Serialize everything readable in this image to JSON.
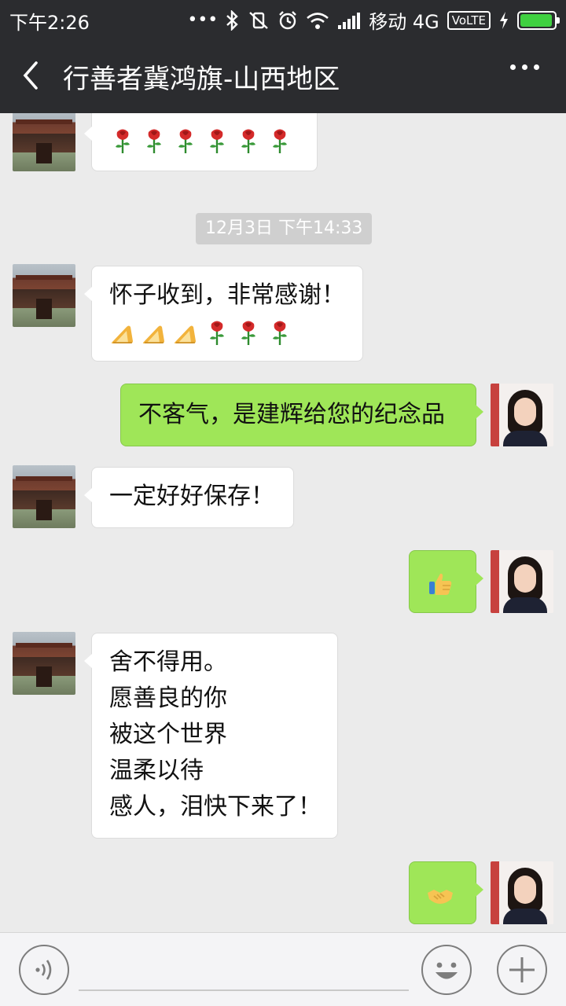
{
  "status": {
    "time": "下午2:26",
    "carrier": "移动 4G",
    "volte": "VoLTE",
    "battery_level": 0.95,
    "icons": [
      "more-dots-icon",
      "bluetooth-icon",
      "silent-icon",
      "alarm-icon",
      "wifi-icon",
      "signal-icon",
      "charging-icon"
    ]
  },
  "header": {
    "title": "行善者冀鸿旗-山西地区",
    "back_icon": "chevron-left-icon",
    "more_icon": "more-icon"
  },
  "chat": {
    "timestamp": "12月3日 下午14:33",
    "messages": [
      {
        "from": "them",
        "emoji": [
          "rose",
          "rose",
          "rose",
          "rose",
          "rose",
          "rose"
        ]
      },
      {
        "from": "them",
        "lines": [
          "怀子收到，非常感谢！"
        ],
        "emoji": [
          "prayer",
          "prayer",
          "prayer",
          "rose",
          "rose",
          "rose"
        ]
      },
      {
        "from": "me",
        "lines": [
          "不客气，是建辉给您的纪念品"
        ]
      },
      {
        "from": "them",
        "lines": [
          "一定好好保存！"
        ]
      },
      {
        "from": "me",
        "emoji": [
          "thumbs-up"
        ]
      },
      {
        "from": "them",
        "lines": [
          "舍不得用。",
          "愿善良的你",
          "被这个世界",
          "温柔以待",
          "感人，泪快下来了！"
        ]
      },
      {
        "from": "me",
        "emoji": [
          "handshake"
        ]
      }
    ]
  },
  "input": {
    "voice_icon": "voice-icon",
    "emoji_icon": "smile-icon",
    "more_icon": "plus-icon"
  },
  "colors": {
    "bar_bg": "#2b2c2f",
    "chat_bg": "#ebebeb",
    "outgoing_bubble": "#9fe658",
    "incoming_bubble": "#ffffff"
  }
}
